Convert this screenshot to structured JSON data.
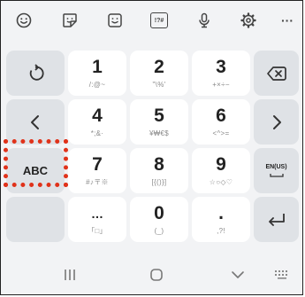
{
  "toolbar": {
    "icons": [
      "emoji-icon",
      "sticker-icon",
      "emoticon-icon",
      "symbols-icon",
      "microphone-icon",
      "settings-icon",
      "more-icon"
    ],
    "symbols_label": "!?#",
    "more_label": "···"
  },
  "keys": {
    "k1": {
      "main": "1",
      "sub": "/:@~"
    },
    "k2": {
      "main": "2",
      "sub": "\"\\%'"
    },
    "k3": {
      "main": "3",
      "sub": "+×÷−"
    },
    "k4": {
      "main": "4",
      "sub": "*;&·"
    },
    "k5": {
      "main": "5",
      "sub": "¥₩€$"
    },
    "k6": {
      "main": "6",
      "sub": "<^>="
    },
    "k7": {
      "main": "7",
      "sub": "#♪〒※"
    },
    "k8": {
      "main": "8",
      "sub": "[{()}]"
    },
    "k9": {
      "main": "9",
      "sub": "☆○◇♡"
    },
    "k_ellipsis": {
      "main": "…",
      "sub": "「□」"
    },
    "k0": {
      "main": "0",
      "sub": "(_)"
    },
    "k_period": {
      "main": ".",
      "sub": ",?!"
    },
    "abc_label": "ABC",
    "lang_label": "EN(US)"
  },
  "highlight": {
    "target": "ABC",
    "color": "#e0321a"
  },
  "navbar": {
    "icons": [
      "recent-apps-icon",
      "home-icon",
      "hide-keyboard-icon",
      "keyboard-switch-icon"
    ]
  }
}
